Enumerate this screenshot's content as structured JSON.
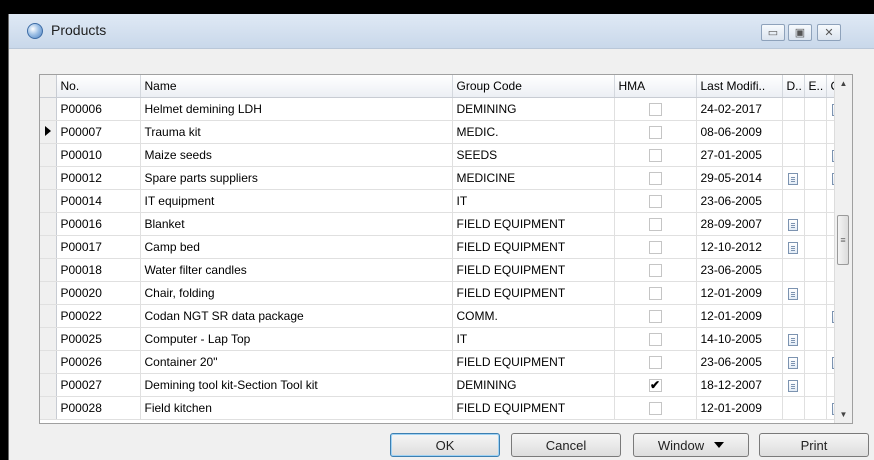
{
  "window": {
    "title": "Products"
  },
  "columns": [
    "No.",
    "Name",
    "Group Code",
    "HMA",
    "Last Modifi..",
    "D..",
    "E..",
    "C.."
  ],
  "rows": [
    {
      "no": "P00006",
      "name": "Helmet demining LDH",
      "group": "DEMINING",
      "hma": false,
      "modified": "24-02-2017",
      "d": false,
      "e": false,
      "c": true,
      "current": false
    },
    {
      "no": "P00007",
      "name": "Trauma kit",
      "group": "MEDIC.",
      "hma": false,
      "modified": "08-06-2009",
      "d": false,
      "e": false,
      "c": false,
      "current": true
    },
    {
      "no": "P00010",
      "name": "Maize seeds",
      "group": "SEEDS",
      "hma": false,
      "modified": "27-01-2005",
      "d": false,
      "e": false,
      "c": true,
      "current": false
    },
    {
      "no": "P00012",
      "name": "Spare parts suppliers",
      "group": "MEDICINE",
      "hma": false,
      "modified": "29-05-2014",
      "d": true,
      "e": false,
      "c": true,
      "current": false
    },
    {
      "no": "P00014",
      "name": "IT equipment",
      "group": "IT",
      "hma": false,
      "modified": "23-06-2005",
      "d": false,
      "e": false,
      "c": false,
      "current": false
    },
    {
      "no": "P00016",
      "name": "Blanket",
      "group": "FIELD EQUIPMENT",
      "hma": false,
      "modified": "28-09-2007",
      "d": true,
      "e": false,
      "c": false,
      "current": false
    },
    {
      "no": "P00017",
      "name": "Camp bed",
      "group": "FIELD EQUIPMENT",
      "hma": false,
      "modified": "12-10-2012",
      "d": true,
      "e": false,
      "c": false,
      "current": false
    },
    {
      "no": "P00018",
      "name": "Water filter candles",
      "group": "FIELD EQUIPMENT",
      "hma": false,
      "modified": "23-06-2005",
      "d": false,
      "e": false,
      "c": false,
      "current": false
    },
    {
      "no": "P00020",
      "name": "Chair, folding",
      "group": "FIELD EQUIPMENT",
      "hma": false,
      "modified": "12-01-2009",
      "d": true,
      "e": false,
      "c": false,
      "current": false
    },
    {
      "no": "P00022",
      "name": "Codan NGT SR data package",
      "group": "COMM.",
      "hma": false,
      "modified": "12-01-2009",
      "d": false,
      "e": false,
      "c": true,
      "current": false
    },
    {
      "no": "P00025",
      "name": "Computer - Lap Top",
      "group": "IT",
      "hma": false,
      "modified": "14-10-2005",
      "d": true,
      "e": false,
      "c": false,
      "current": false
    },
    {
      "no": "P00026",
      "name": "Container 20\"",
      "group": "FIELD EQUIPMENT",
      "hma": false,
      "modified": "23-06-2005",
      "d": true,
      "e": false,
      "c": true,
      "current": false
    },
    {
      "no": "P00027",
      "name": "Demining tool kit-Section Tool kit",
      "group": "DEMINING",
      "hma": true,
      "modified": "18-12-2007",
      "d": true,
      "e": false,
      "c": false,
      "current": false
    },
    {
      "no": "P00028",
      "name": "Field kitchen",
      "group": "FIELD EQUIPMENT",
      "hma": false,
      "modified": "12-01-2009",
      "d": false,
      "e": false,
      "c": true,
      "current": false
    }
  ],
  "buttons": {
    "ok": "OK",
    "cancel": "Cancel",
    "window": "Window",
    "print": "Print"
  },
  "icons": {
    "app": "products-app-icon",
    "document": "document-icon",
    "checkmark": "✔"
  }
}
